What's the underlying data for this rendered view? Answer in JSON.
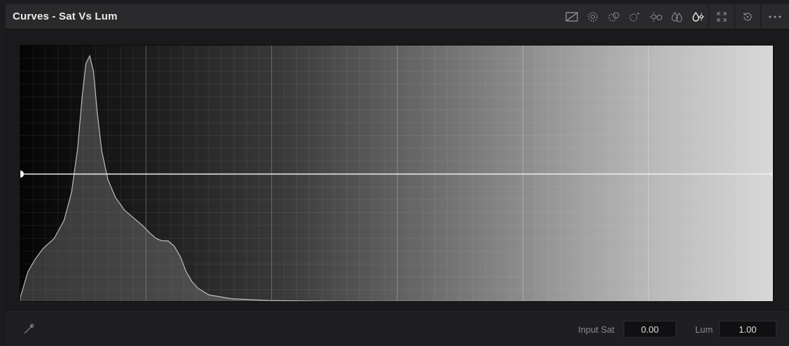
{
  "header": {
    "title": "Curves - Sat Vs Lum"
  },
  "toolbar": {
    "icons": [
      "custom-curve-icon",
      "hue-vs-hue-icon",
      "hue-vs-sat-icon",
      "hue-vs-lum-icon",
      "lum-vs-sat-icon",
      "sat-vs-sat-icon",
      "sat-vs-lum-icon",
      "expand-icon",
      "reset-icon",
      "more-options-icon"
    ],
    "active": "sat-vs-lum-icon"
  },
  "curve": {
    "type": "Sat Vs Lum",
    "control_points": [
      {
        "sat": 0.0,
        "lum": 1.0
      },
      {
        "sat": 1.0,
        "lum": 1.0
      }
    ],
    "histogram": [
      [
        0.0,
        0.02
      ],
      [
        0.004,
        0.06
      ],
      [
        0.01,
        0.12
      ],
      [
        0.02,
        0.17
      ],
      [
        0.03,
        0.21
      ],
      [
        0.045,
        0.25
      ],
      [
        0.058,
        0.32
      ],
      [
        0.068,
        0.43
      ],
      [
        0.076,
        0.6
      ],
      [
        0.082,
        0.8
      ],
      [
        0.087,
        0.93
      ],
      [
        0.092,
        0.96
      ],
      [
        0.097,
        0.9
      ],
      [
        0.102,
        0.74
      ],
      [
        0.108,
        0.59
      ],
      [
        0.116,
        0.48
      ],
      [
        0.126,
        0.41
      ],
      [
        0.138,
        0.36
      ],
      [
        0.15,
        0.33
      ],
      [
        0.162,
        0.3
      ],
      [
        0.172,
        0.27
      ],
      [
        0.18,
        0.25
      ],
      [
        0.188,
        0.24
      ],
      [
        0.196,
        0.24
      ],
      [
        0.204,
        0.22
      ],
      [
        0.212,
        0.18
      ],
      [
        0.22,
        0.12
      ],
      [
        0.228,
        0.08
      ],
      [
        0.236,
        0.055
      ],
      [
        0.25,
        0.03
      ],
      [
        0.28,
        0.015
      ],
      [
        0.33,
        0.008
      ],
      [
        0.42,
        0.005
      ],
      [
        0.6,
        0.004
      ],
      [
        1.0,
        0.003
      ]
    ]
  },
  "colors": {
    "curve_line": "#f0f0f0",
    "histogram_fill": "rgba(150,150,150,0.35)",
    "histogram_stroke": "#bdbdbd"
  },
  "footer": {
    "input_sat_label": "Input Sat",
    "input_sat_value": "0.00",
    "lum_label": "Lum",
    "lum_value": "1.00"
  }
}
